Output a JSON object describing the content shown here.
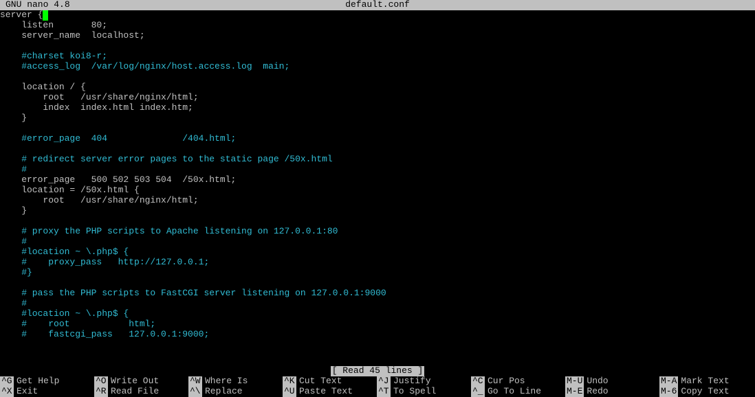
{
  "titlebar": {
    "app": "  GNU nano 4.8",
    "filename": "default.conf"
  },
  "editor": {
    "lines": [
      {
        "type": "with-cursor",
        "text": "server {"
      },
      {
        "type": "normal",
        "text": "    listen       80;"
      },
      {
        "type": "normal",
        "text": "    server_name  localhost;"
      },
      {
        "type": "blank",
        "text": ""
      },
      {
        "type": "comment",
        "text": "    #charset koi8-r;"
      },
      {
        "type": "comment",
        "text": "    #access_log  /var/log/nginx/host.access.log  main;"
      },
      {
        "type": "blank",
        "text": ""
      },
      {
        "type": "normal",
        "text": "    location / {"
      },
      {
        "type": "normal",
        "text": "        root   /usr/share/nginx/html;"
      },
      {
        "type": "normal",
        "text": "        index  index.html index.htm;"
      },
      {
        "type": "normal",
        "text": "    }"
      },
      {
        "type": "blank",
        "text": ""
      },
      {
        "type": "comment",
        "text": "    #error_page  404              /404.html;"
      },
      {
        "type": "blank",
        "text": ""
      },
      {
        "type": "comment",
        "text": "    # redirect server error pages to the static page /50x.html"
      },
      {
        "type": "comment",
        "text": "    #"
      },
      {
        "type": "normal",
        "text": "    error_page   500 502 503 504  /50x.html;"
      },
      {
        "type": "normal",
        "text": "    location = /50x.html {"
      },
      {
        "type": "normal",
        "text": "        root   /usr/share/nginx/html;"
      },
      {
        "type": "normal",
        "text": "    }"
      },
      {
        "type": "blank",
        "text": ""
      },
      {
        "type": "comment",
        "text": "    # proxy the PHP scripts to Apache listening on 127.0.0.1:80"
      },
      {
        "type": "comment",
        "text": "    #"
      },
      {
        "type": "comment",
        "text": "    #location ~ \\.php$ {"
      },
      {
        "type": "comment",
        "text": "    #    proxy_pass   http://127.0.0.1;"
      },
      {
        "type": "comment",
        "text": "    #}"
      },
      {
        "type": "blank",
        "text": ""
      },
      {
        "type": "comment",
        "text": "    # pass the PHP scripts to FastCGI server listening on 127.0.0.1:9000"
      },
      {
        "type": "comment",
        "text": "    #"
      },
      {
        "type": "comment",
        "text": "    #location ~ \\.php$ {"
      },
      {
        "type": "comment",
        "text": "    #    root           html;"
      },
      {
        "type": "comment",
        "text": "    #    fastcgi_pass   127.0.0.1:9000;"
      }
    ]
  },
  "status": "[ Read 45 lines ]",
  "help": {
    "row1": [
      {
        "key": "^G",
        "label": "Get Help"
      },
      {
        "key": "^O",
        "label": "Write Out"
      },
      {
        "key": "^W",
        "label": "Where Is"
      },
      {
        "key": "^K",
        "label": "Cut Text"
      },
      {
        "key": "^J",
        "label": "Justify"
      },
      {
        "key": "^C",
        "label": "Cur Pos"
      },
      {
        "key": "M-U",
        "label": "Undo"
      },
      {
        "key": "M-A",
        "label": "Mark Text"
      }
    ],
    "row2": [
      {
        "key": "^X",
        "label": "Exit"
      },
      {
        "key": "^R",
        "label": "Read File"
      },
      {
        "key": "^\\",
        "label": "Replace"
      },
      {
        "key": "^U",
        "label": "Paste Text"
      },
      {
        "key": "^T",
        "label": "To Spell"
      },
      {
        "key": "^_",
        "label": "Go To Line"
      },
      {
        "key": "M-E",
        "label": "Redo"
      },
      {
        "key": "M-6",
        "label": "Copy Text"
      }
    ]
  }
}
